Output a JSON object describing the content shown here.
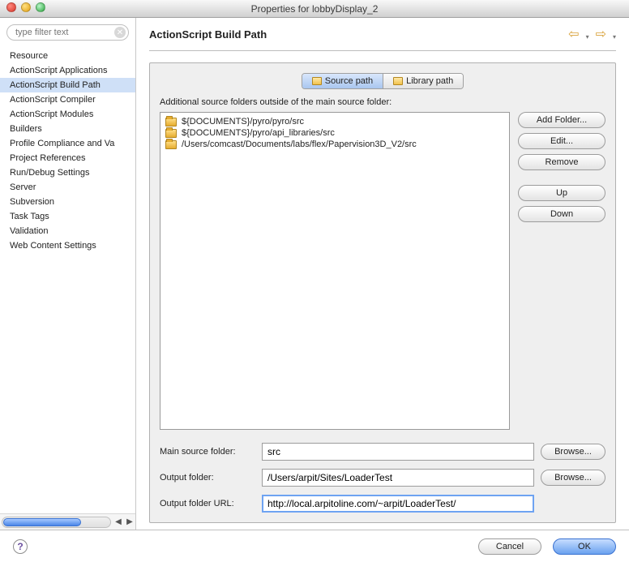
{
  "window": {
    "title": "Properties for lobbyDisplay_2"
  },
  "filter": {
    "value": "",
    "placeholder": "type filter text"
  },
  "categories": [
    {
      "label": "Resource",
      "selected": false
    },
    {
      "label": "ActionScript Applications",
      "selected": false
    },
    {
      "label": "ActionScript Build Path",
      "selected": true
    },
    {
      "label": "ActionScript Compiler",
      "selected": false
    },
    {
      "label": "ActionScript Modules",
      "selected": false
    },
    {
      "label": "Builders",
      "selected": false
    },
    {
      "label": "Profile Compliance and Va",
      "selected": false
    },
    {
      "label": "Project References",
      "selected": false
    },
    {
      "label": "Run/Debug Settings",
      "selected": false
    },
    {
      "label": "Server",
      "selected": false
    },
    {
      "label": "Subversion",
      "selected": false
    },
    {
      "label": "Task Tags",
      "selected": false
    },
    {
      "label": "Validation",
      "selected": false
    },
    {
      "label": "Web Content Settings",
      "selected": false
    }
  ],
  "mainTitle": "ActionScript Build Path",
  "tabs": {
    "source": "Source path",
    "library": "Library path"
  },
  "subtitle": "Additional source folders outside of the main source folder:",
  "sourceFolders": [
    "${DOCUMENTS}/pyro/pyro/src",
    "${DOCUMENTS}/pyro/api_libraries/src",
    "/Users/comcast/Documents/labs/flex/Papervision3D_V2/src"
  ],
  "sideButtons": {
    "addFolder": "Add Folder...",
    "edit": "Edit...",
    "remove": "Remove",
    "up": "Up",
    "down": "Down"
  },
  "fields": {
    "mainSource": {
      "label": "Main source folder:",
      "value": "src",
      "browse": "Browse..."
    },
    "outputFolder": {
      "label": "Output folder:",
      "value": "/Users/arpit/Sites/LoaderTest",
      "browse": "Browse..."
    },
    "outputUrl": {
      "label": "Output folder URL:",
      "value": "http://local.arpitoline.com/~arpit/LoaderTest/"
    }
  },
  "bottom": {
    "help": "?",
    "cancel": "Cancel",
    "ok": "OK"
  }
}
